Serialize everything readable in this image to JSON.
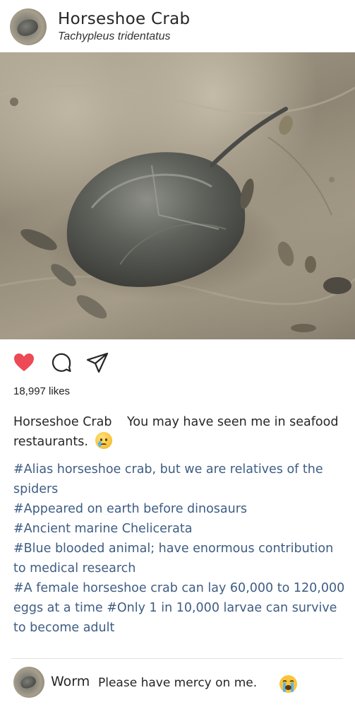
{
  "post": {
    "author": "Horseshoe Crab",
    "scientific_name": "Tachypleus tridentatus"
  },
  "photo": {
    "subject": "horseshoe crab on sandy beach with shells"
  },
  "actions": {
    "like_icon": "heart-icon",
    "comment_icon": "comment-icon",
    "share_icon": "send-icon",
    "liked": true,
    "like_color": "#ed4956"
  },
  "likes": "18,997 likes",
  "caption": {
    "author": "Horseshoe Crab",
    "text": "You may have seen me in seafood restaurants.",
    "emoji": "crying-face-emoji"
  },
  "hashtags": [
    "#Alias horseshoe crab, but we are relatives of the spiders",
    "#Appeared on earth before dinosaurs",
    "#Ancient marine Chelicerata",
    "#Blue blooded animal; have enormous contribution to medical research",
    "#A female horseshoe crab can lay 60,000 to 120,000 eggs at a time #Only 1 in 10,000 larvae can survive to become adult"
  ],
  "hashtag_color": "#3e5d83",
  "comments": [
    {
      "user": "Worm",
      "text": "Please have mercy on me.",
      "emoji": "loudly-crying-face-emoji"
    }
  ]
}
